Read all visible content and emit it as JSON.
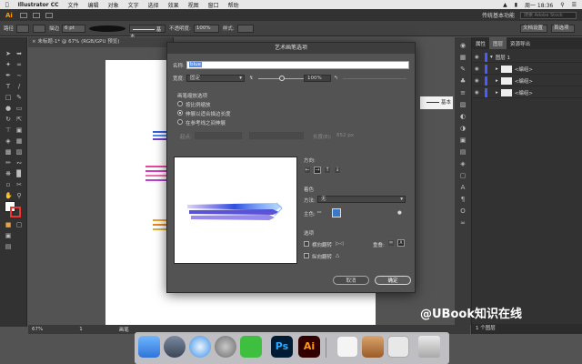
{
  "menubar": {
    "items": [
      "Illustrator CC",
      "文件",
      "编辑",
      "对象",
      "文字",
      "选择",
      "效果",
      "视图",
      "窗口",
      "帮助"
    ],
    "time": "周一 18:36"
  },
  "appbar": {
    "logo": "Ai",
    "workspace": "传统基本功能",
    "search_placeholder": "搜索 Adobe Stock"
  },
  "ctrlbar": {
    "object_type": "路径",
    "stroke_label": "描边",
    "stroke_value": "6 pt",
    "brush_name": "基本",
    "opacity_label": "不透明度:",
    "opacity_value": "100%",
    "style_label": "样式:",
    "doc_setup": "文档设置",
    "prefs": "首选项"
  },
  "doctab": {
    "title": "未标题-1* @ 67% (RGB/GPU 预览)"
  },
  "statusbar": {
    "zoom": "67%",
    "page": "1",
    "tool": "画笔"
  },
  "right_panel": {
    "tabs": [
      "属性",
      "图层",
      "资源导出"
    ],
    "layers": [
      {
        "name": "图层 1"
      },
      {
        "name": "<编组>"
      },
      {
        "name": "<编组>"
      },
      {
        "name": "<编组>"
      }
    ],
    "footer": "1 个图层",
    "brush_label": "基本"
  },
  "dialog": {
    "title": "艺术画笔选项",
    "name_label": "名称:",
    "name_value": "blue",
    "width_label": "宽度:",
    "width_value": "固定",
    "width_percent": "100%",
    "scale_options_label": "画笔缩放选项",
    "scale_opts": [
      "按比例缩放",
      "伸展以适合描边长度",
      "在参考线之间伸展"
    ],
    "start_label": "起点:",
    "length_label": "长度(E):",
    "length_value": "652 px",
    "direction_label": "方向:",
    "coloring_label": "着色",
    "method_label": "方法:",
    "method_value": "无",
    "keycolor_label": "主色:",
    "options_label": "选项",
    "flip_h": "横向翻转",
    "flip_v": "纵向翻转",
    "overlap_label": "重叠:",
    "cancel": "取消",
    "ok": "确定"
  },
  "watermark": "@UBook知识在线",
  "colors": {
    "accent_blue": "#2f6bd6",
    "key_color": "#3a78c9",
    "ai_orange": "#ff9a00"
  }
}
